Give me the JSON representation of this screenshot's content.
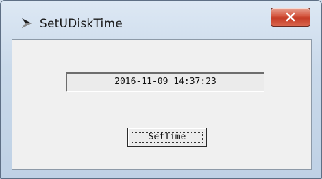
{
  "window": {
    "title": "SetUDiskTime",
    "close_icon": "close-icon",
    "app_icon": "app-icon"
  },
  "content": {
    "datetime_value": "2016-11-09 14:37:23",
    "set_button_label": "SetTime"
  },
  "colors": {
    "close_button": "#c9442d",
    "client_bg": "#f0f0f0",
    "frame": "#c9d9ea"
  }
}
